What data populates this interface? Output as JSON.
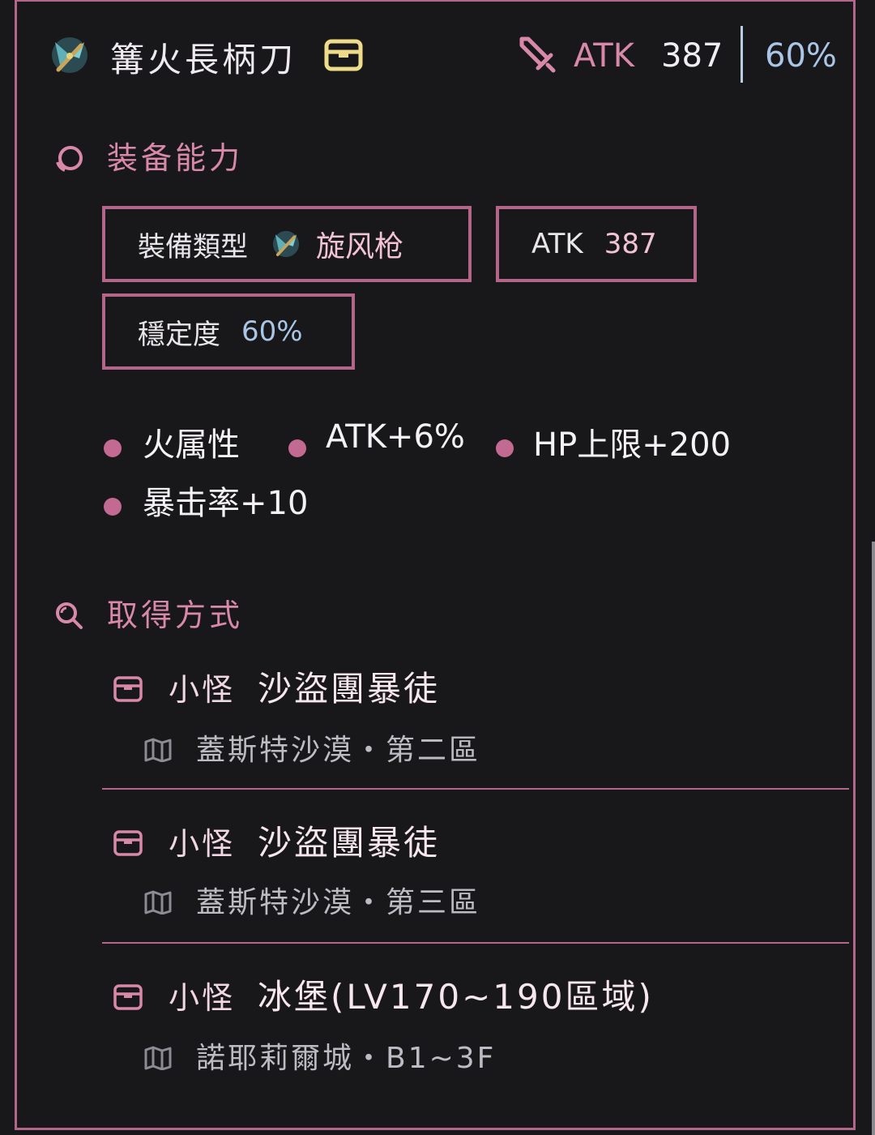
{
  "header": {
    "item_name": "篝火長柄刀",
    "atk_label": "ATK",
    "atk_value": "387",
    "stability_value": "60%"
  },
  "abilities": {
    "title": "装备能力",
    "type_label": "裝備類型",
    "type_value": "旋风枪",
    "atk_label": "ATK",
    "atk_value": "387",
    "stability_label": "穩定度",
    "stability_value": "60%"
  },
  "traits": [
    "火属性",
    "ATK+6%",
    "HP上限+200",
    "暴击率+10"
  ],
  "acquisition": {
    "title": "取得方式",
    "sources": [
      {
        "type": "小怪",
        "name": "沙盜團暴徒",
        "location": "蓋斯特沙漠・第二區"
      },
      {
        "type": "小怪",
        "name": "沙盜團暴徒",
        "location": "蓋斯特沙漠・第三區"
      },
      {
        "type": "小怪",
        "name": "冰堡(LV170~190區域)",
        "location": "諾耶莉爾城・B1~3F"
      }
    ]
  },
  "colors": {
    "accent": "#b4668a",
    "pink_text": "#d889a8",
    "blue_text": "#a9c6e6",
    "background": "#18171a"
  },
  "icons": {
    "weapon": "halberd-icon",
    "box": "treasure-box-icon",
    "sword": "sword-icon",
    "ability": "swirl-icon",
    "search": "search-icon",
    "map": "map-icon"
  }
}
